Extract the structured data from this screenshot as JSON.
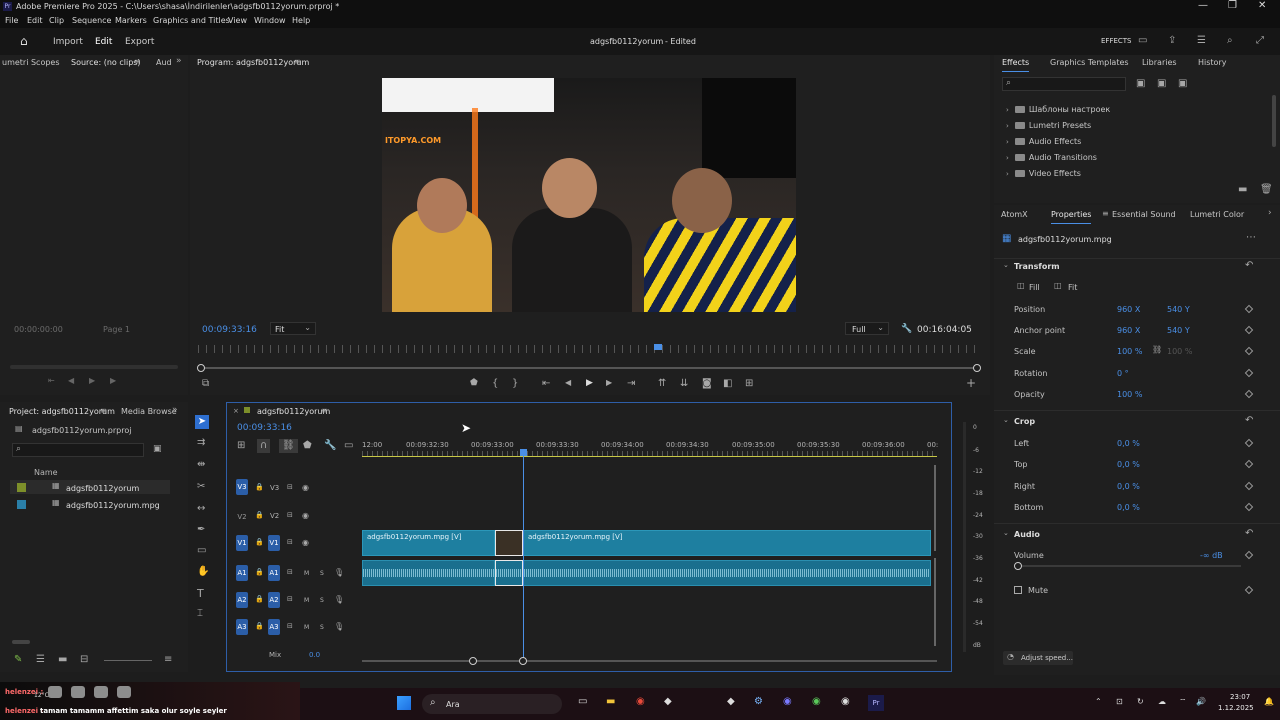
{
  "window": {
    "title": "Adobe Premiere Pro 2025 - C:\\Users\\shasa\\İndirilenler\\adgsfb0112yorum.prproj *",
    "app_icon": "Pr"
  },
  "menu": [
    "File",
    "Edit",
    "Clip",
    "Sequence",
    "Markers",
    "Graphics and Titles",
    "View",
    "Window",
    "Help"
  ],
  "header": {
    "tabs": [
      "Import",
      "Edit",
      "Export"
    ],
    "project_title": "adgsfb0112yorum",
    "status": "- Edited",
    "effects_label": "EFFECTS"
  },
  "source": {
    "tab_left": "umetri Scopes",
    "tab_active": "Source: (no clips)",
    "tab_right": "Aud",
    "timecode": "00:00:00:00",
    "page": "Page 1"
  },
  "program": {
    "tab": "Program: adgsfb0112yorum",
    "timecode": "00:09:33:16",
    "fit": "Fit",
    "quality": "Full",
    "duration": "00:16:04:05",
    "playhead_fraction": 0.59
  },
  "project": {
    "tab": "Project: adgsfb0112yorum",
    "tab2": "Media Browse",
    "file": "adgsfb0112yorum.prproj",
    "col_name": "Name",
    "items": [
      "adgsfb0112yorum",
      "adgsfb0112yorum.mpg"
    ],
    "item_colors": [
      "#7d8f2a",
      "#2a7fa8"
    ]
  },
  "timeline": {
    "tab": "adgsfb0112yorum",
    "timecode": "00:09:33:16",
    "ruler": [
      "12:00",
      "00:09:32:30",
      "00:09:33:00",
      "00:09:33:30",
      "00:09:34:00",
      "00:09:34:30",
      "00:09:35:00",
      "00:09:35:30",
      "00:09:36:00",
      "00:"
    ],
    "tracks_video": [
      {
        "src": "V3",
        "label": "V3"
      },
      {
        "src": "V2",
        "label": "V2"
      },
      {
        "src": "V1",
        "label": "V1"
      }
    ],
    "tracks_audio": [
      {
        "src": "A1",
        "label": "A1"
      },
      {
        "src": "A2",
        "label": "A2"
      },
      {
        "src": "A3",
        "label": "A3"
      }
    ],
    "clip1": "adgsfb0112yorum.mpg [V]",
    "clip2": "adgsfb0112yorum.mpg [V]",
    "mix": "Mix",
    "mix_val": "0.0",
    "meter": [
      "0",
      "-6",
      "-12",
      "-18",
      "-24",
      "-30",
      "-36",
      "-42",
      "-48",
      "-54",
      "dB"
    ],
    "sm": [
      "M",
      "S"
    ]
  },
  "effects": {
    "tabs": [
      "Effects",
      "Graphics Templates",
      "Libraries",
      "History"
    ],
    "folders": [
      "Шаблоны настроек",
      "Lumetri Presets",
      "Audio Effects",
      "Audio Transitions",
      "Video Effects"
    ]
  },
  "properties": {
    "tabs": [
      "AtomX",
      "Properties",
      "Essential Sound",
      "Lumetri Color"
    ],
    "clip": "adgsfb0112yorum.mpg",
    "transform": "Transform",
    "fill": "Fill",
    "fit": "Fit",
    "rows": [
      {
        "label": "Position",
        "v1": "960 X",
        "v2": "540 Y"
      },
      {
        "label": "Anchor point",
        "v1": "960 X",
        "v2": "540 Y"
      },
      {
        "label": "Scale",
        "v1": "100 %",
        "v2": "100 %"
      },
      {
        "label": "Rotation",
        "v1": "0 °",
        "v2": ""
      },
      {
        "label": "Opacity",
        "v1": "100 %",
        "v2": ""
      }
    ],
    "crop": "Crop",
    "crop_rows": [
      {
        "label": "Left",
        "v": "0,0 %"
      },
      {
        "label": "Top",
        "v": "0,0 %"
      },
      {
        "label": "Right",
        "v": "0,0 %"
      },
      {
        "label": "Bottom",
        "v": "0,0 %"
      }
    ],
    "audio": "Audio",
    "volume": "Volume",
    "volume_val": "-∞ dB",
    "mute": "Mute",
    "adjust": "Adjust speed..."
  },
  "overlay": {
    "name1": "helenzei :",
    "name2": "helenzei :",
    "emotes_text": "12°C",
    "chat": "tamam tamamm affettim saka olur soyle seyler",
    "game_text": "ITOPYA.COM"
  },
  "taskbar": {
    "search": "Ara",
    "time": "23:07",
    "date": "1.12.2025"
  }
}
